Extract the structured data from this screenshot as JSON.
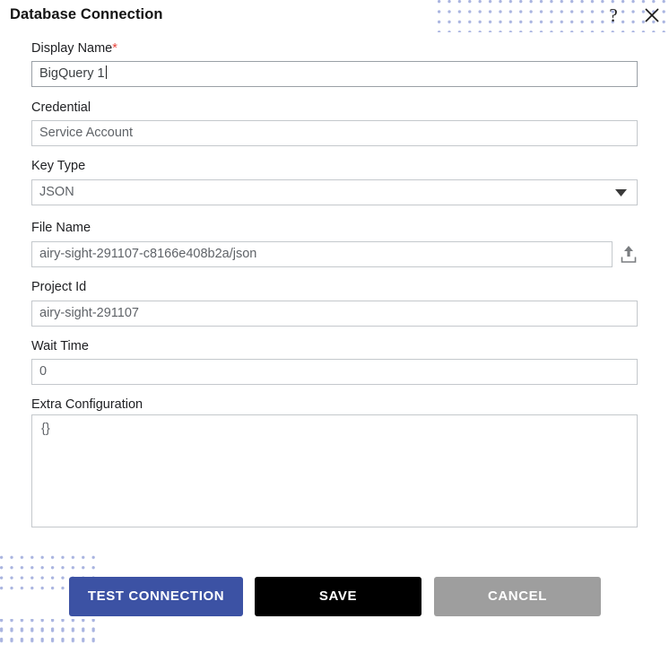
{
  "dialog": {
    "title": "Database Connection",
    "help_icon": "question-mark-icon",
    "close_icon": "close-icon"
  },
  "fields": {
    "display_name": {
      "label": "Display Name",
      "required_marker": "*",
      "value": "BigQuery 1",
      "focused": true
    },
    "credential": {
      "label": "Credential",
      "value": "Service Account"
    },
    "key_type": {
      "label": "Key Type",
      "value": "JSON",
      "arrow_icon": "chevron-down-icon"
    },
    "file_name": {
      "label": "File Name",
      "value": "airy-sight-291107-c8166e408b2a/json",
      "upload_icon": "upload-icon"
    },
    "project_id": {
      "label": "Project Id",
      "value": "airy-sight-291107"
    },
    "wait_time": {
      "label": "Wait Time",
      "value": "0"
    },
    "extra_configuration": {
      "label": "Extra Configuration",
      "value": "{}"
    }
  },
  "footer": {
    "test_connection_label": "TEST CONNECTION",
    "save_label": "SAVE",
    "cancel_label": "CANCEL"
  },
  "colors": {
    "primary_blue": "#3c52a4",
    "save_black": "#000000",
    "cancel_gray": "#9e9e9e",
    "required_red": "#e8453c",
    "dot_pattern": "#a9b4e0",
    "field_border": "#c4c8cc"
  }
}
